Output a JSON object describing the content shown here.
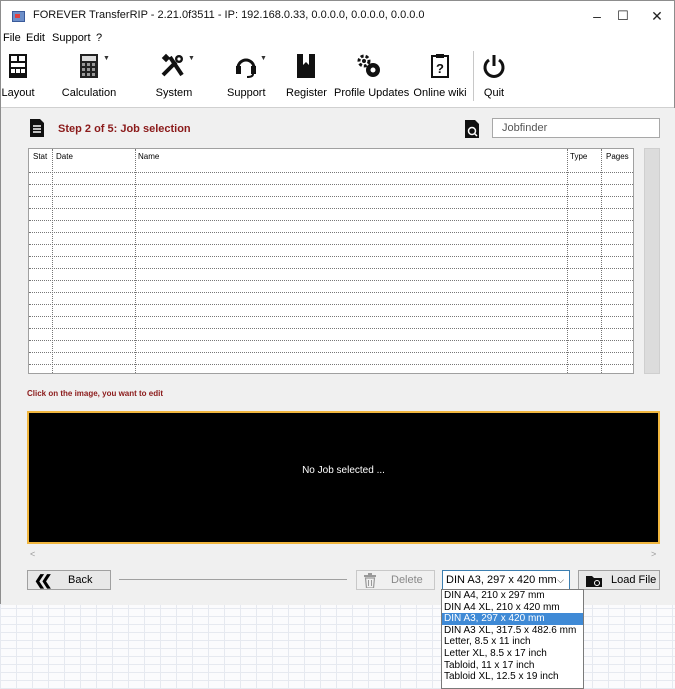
{
  "window": {
    "title": "FOREVER TransferRIP - 2.21.0f3511 - IP: 192.168.0.33, 0.0.0.0, 0.0.0.0, 0.0.0.0",
    "minimize": "–",
    "maximize": "☐",
    "close": "✕"
  },
  "menu": {
    "items": [
      "File",
      "Edit",
      "Support",
      "?"
    ]
  },
  "toolbar": {
    "layout": "Layout",
    "calculation": "Calculation",
    "system": "System",
    "support": "Support",
    "register": "Register",
    "profile_updates": "Profile Updates",
    "online_wiki": "Online wiki",
    "quit": "Quit"
  },
  "step": {
    "title": "Step 2 of 5: Job selection"
  },
  "jobfinder": {
    "placeholder": "Jobfinder"
  },
  "table": {
    "headers": [
      "Stat",
      "Date",
      "Name",
      "Type",
      "Pages"
    ],
    "rows": []
  },
  "hint": "Click on the image, you want to edit",
  "preview": {
    "empty_text": "No Job selected ..."
  },
  "bottom": {
    "back": "Back",
    "delete": "Delete",
    "format_selected": "DIN A3, 297 x 420 mm",
    "load_file": "Load File"
  },
  "format_options": [
    "DIN A4, 210 x 297 mm",
    "DIN A4 XL, 210 x 420 mm",
    "DIN A3, 297 x 420 mm",
    "DIN A3 XL, 317.5 x 482.6 mm",
    "Letter, 8.5 x 11 inch",
    "Letter XL, 8.5 x 17 inch",
    "Tabloid, 11 x 17 inch",
    "Tabloid XL, 12.5 x 19 inch"
  ],
  "format_selected_index": 2,
  "colors": {
    "accent_red": "#8b1a1a",
    "preview_border": "#f0b63f",
    "selection_blue": "#3f8ad6"
  }
}
